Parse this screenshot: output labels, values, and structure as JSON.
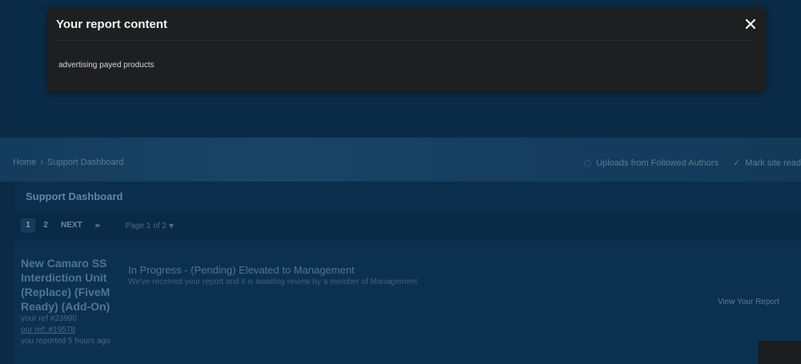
{
  "modal": {
    "title": "Your report content",
    "close_icon": "close-icon",
    "body": "advertising payed products"
  },
  "breadcrumb": {
    "items": [
      "Home",
      "Support Dashboard"
    ]
  },
  "band_actions": {
    "uploads_label": "Uploads from Followed Authors",
    "mark_read_label": "Mark site read"
  },
  "dashboard": {
    "title": "Support Dashboard",
    "pagination": {
      "pages": [
        "1",
        "2"
      ],
      "next_label": "NEXT",
      "last_icon": "double-chevron-right-icon",
      "page_of": "Page 1 of 2"
    },
    "report": {
      "title": "New Camaro SS Interdiction Unit (Replace) (FiveM Ready) (Add-On)",
      "your_ref": "your ref #23990",
      "our_ref": "our ref: #19578",
      "reported": "you reported 5 hours ago",
      "status_title": "In Progress - (Pending) Elevated to Management",
      "status_desc": "We've received your report and it is awaiting review by a member of Management.",
      "view_label": "View Your Report"
    }
  }
}
